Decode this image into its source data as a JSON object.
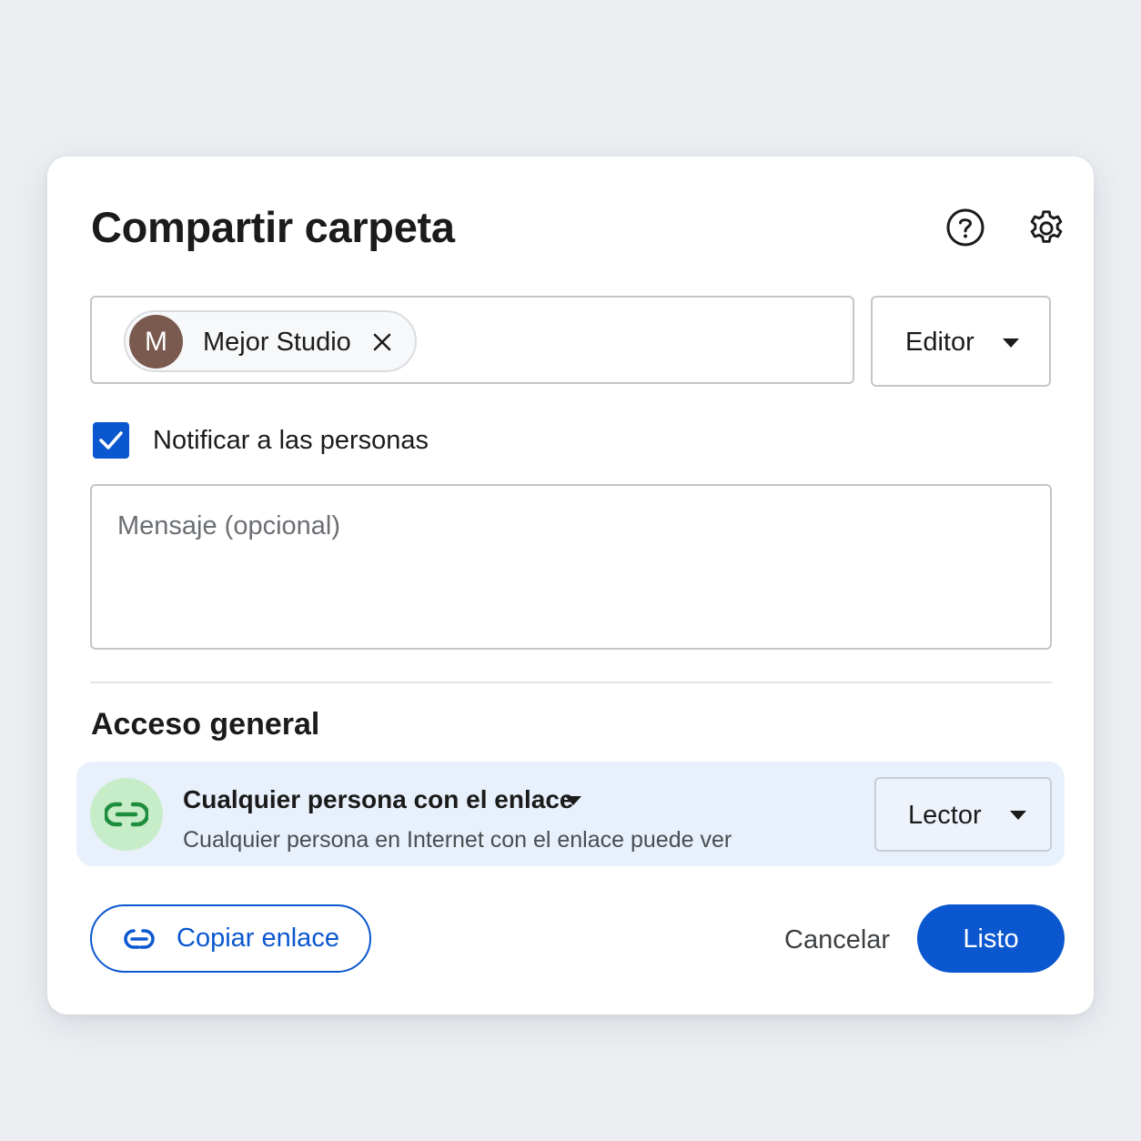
{
  "dialog": {
    "title": "Compartir carpeta",
    "help_icon": "help-circle-icon",
    "settings_icon": "gear-icon"
  },
  "recipients": {
    "chips": [
      {
        "avatar_letter": "M",
        "name": "Mejor Studio",
        "avatar_color": "#7a5a4f"
      }
    ],
    "role": "Editor"
  },
  "notify": {
    "checked": true,
    "label": "Notificar a las personas"
  },
  "message": {
    "placeholder": "Mensaje (opcional)",
    "value": ""
  },
  "general_access": {
    "heading": "Acceso general",
    "scope": "Cualquier persona con el enlace",
    "description": "Cualquier persona en Internet con el enlace puede ver",
    "role": "Lector",
    "icon": "link-icon"
  },
  "footer": {
    "copy_link": "Copiar enlace",
    "cancel": "Cancelar",
    "done": "Listo"
  },
  "colors": {
    "primary": "#0b57d0",
    "access_bg": "#e8f0fb",
    "link_icon_bg": "#c7ecc8",
    "link_icon": "#1e8e3e"
  }
}
